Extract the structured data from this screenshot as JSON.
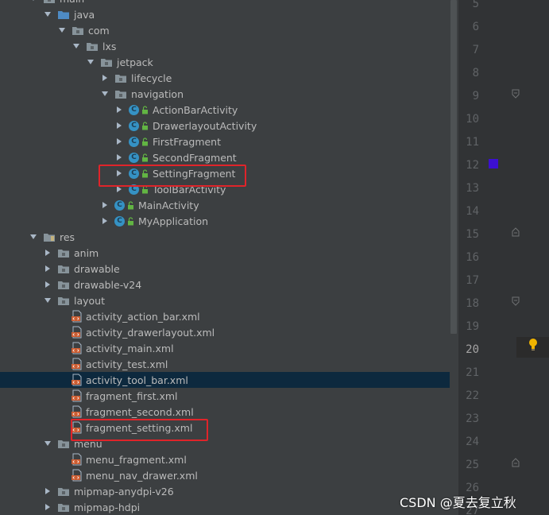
{
  "colors": {
    "panel_bg": "#3c3f41",
    "selected_row": "#0d293e",
    "highlight_border": "#e0242a",
    "class_icon": "#3592c4",
    "color_swatch": "#3c10d1"
  },
  "tree": [
    {
      "label": "main",
      "type": "folder",
      "arrow": "down"
    },
    {
      "label": "java",
      "type": "folder-src",
      "arrow": "down"
    },
    {
      "label": "com",
      "type": "folder",
      "arrow": "down"
    },
    {
      "label": "lxs",
      "type": "folder",
      "arrow": "down"
    },
    {
      "label": "jetpack",
      "type": "folder",
      "arrow": "down"
    },
    {
      "label": "lifecycle",
      "type": "folder",
      "arrow": "right"
    },
    {
      "label": "navigation",
      "type": "folder",
      "arrow": "down"
    },
    {
      "label": "ActionBarActivity",
      "type": "class",
      "arrow": "right"
    },
    {
      "label": "DrawerlayoutActivity",
      "type": "class",
      "arrow": "right"
    },
    {
      "label": "FirstFragment",
      "type": "class",
      "arrow": "right"
    },
    {
      "label": "SecondFragment",
      "type": "class",
      "arrow": "right"
    },
    {
      "label": "SettingFragment",
      "type": "class",
      "arrow": "right"
    },
    {
      "label": "ToolBarActivity",
      "type": "class",
      "arrow": "right"
    },
    {
      "label": "MainActivity",
      "type": "class",
      "arrow": "right"
    },
    {
      "label": "MyApplication",
      "type": "class",
      "arrow": "right"
    },
    {
      "label": "res",
      "type": "folder-res",
      "arrow": "down"
    },
    {
      "label": "anim",
      "type": "folder",
      "arrow": "right"
    },
    {
      "label": "drawable",
      "type": "folder",
      "arrow": "right"
    },
    {
      "label": "drawable-v24",
      "type": "folder",
      "arrow": "right"
    },
    {
      "label": "layout",
      "type": "folder",
      "arrow": "down"
    },
    {
      "label": "activity_action_bar.xml",
      "type": "xml",
      "arrow": "none"
    },
    {
      "label": "activity_drawerlayout.xml",
      "type": "xml",
      "arrow": "none"
    },
    {
      "label": "activity_main.xml",
      "type": "xml",
      "arrow": "none"
    },
    {
      "label": "activity_test.xml",
      "type": "xml",
      "arrow": "none"
    },
    {
      "label": "activity_tool_bar.xml",
      "type": "xml",
      "arrow": "none",
      "selected": true
    },
    {
      "label": "fragment_first.xml",
      "type": "xml",
      "arrow": "none"
    },
    {
      "label": "fragment_second.xml",
      "type": "xml",
      "arrow": "none"
    },
    {
      "label": "fragment_setting.xml",
      "type": "xml",
      "arrow": "none"
    },
    {
      "label": "menu",
      "type": "folder",
      "arrow": "down"
    },
    {
      "label": "menu_fragment.xml",
      "type": "xml",
      "arrow": "none"
    },
    {
      "label": "menu_nav_drawer.xml",
      "type": "xml",
      "arrow": "none"
    },
    {
      "label": "mipmap-anydpi-v26",
      "type": "folder",
      "arrow": "right"
    },
    {
      "label": "mipmap-hdpi",
      "type": "folder",
      "arrow": "right"
    }
  ],
  "gutter": {
    "line_numbers": [
      "5",
      "6",
      "7",
      "8",
      "9",
      "10",
      "11",
      "12",
      "13",
      "14",
      "15",
      "16",
      "17",
      "18",
      "19",
      "20",
      "21",
      "22",
      "23",
      "24",
      "25",
      "26",
      "27"
    ],
    "current_line": "20"
  },
  "watermark": "CSDN @夏去复立秋",
  "icons": {
    "class": "class-icon",
    "folder": "folder-icon",
    "xml": "xml-layout-icon",
    "lock": "lock-icon",
    "bulb": "lightbulb-icon"
  }
}
